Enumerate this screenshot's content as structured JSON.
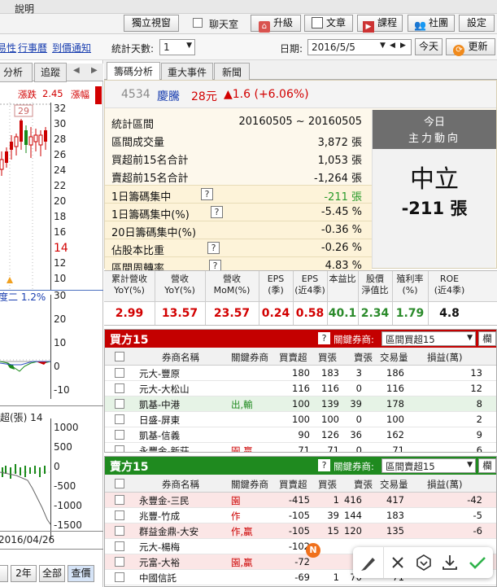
{
  "toolbar": {
    "menu_label": "說明",
    "window_btn": "獨立視窗",
    "chat_label": "聊天室",
    "upgrade_btn": "升級",
    "article_btn": "文章",
    "course_btn": "課程",
    "community_btn": "社團",
    "settings_btn": "設定",
    "links": [
      "易性",
      "行事曆",
      "到價通知"
    ],
    "stat_days_label": "統計天數:",
    "stat_days_value": "1",
    "date_label": "日期:",
    "date_value": "2016/5/5",
    "today_btn": "今天",
    "update_btn": "更新"
  },
  "left": {
    "tabs": [
      "分析",
      "追蹤"
    ],
    "price_change_label": "漲跌",
    "price_change_value": "2.45",
    "amplitude_label": "漲幅",
    "highlight_price": "29",
    "yaxis_top": [
      "32",
      "30",
      "28",
      "26",
      "24",
      "22",
      "20",
      "18",
      "16",
      "14",
      "12",
      "10"
    ],
    "percent_text": "度二 1.2%",
    "yaxis_mid": [
      "30",
      "20",
      "10",
      "0",
      "-10"
    ],
    "volume_label": "超(張) 14",
    "yaxis_bottom": [
      "1000",
      "500",
      "0",
      "-500",
      "-1000",
      "-1500"
    ],
    "date_text": "2016/04/26",
    "range_buttons": [
      "2年",
      "全部",
      "查價"
    ]
  },
  "tabs": [
    "籌碼分析",
    "重大事件",
    "新聞"
  ],
  "stock": {
    "code": "4534",
    "name": "慶騰",
    "price": "28元",
    "change": "▲1.6 (+6.06%)"
  },
  "stats": [
    {
      "label": "統計區間",
      "value": "20160505 ~ 20160505",
      "q": false,
      "color": "#111"
    },
    {
      "label": "區間成交量",
      "value": "3,872 張",
      "q": false,
      "color": "#111"
    },
    {
      "label": "買超前15名合計",
      "value": "1,053 張",
      "q": false,
      "color": "#111"
    },
    {
      "label": "賣超前15名合計",
      "value": "-1,264 張",
      "q": false,
      "color": "#111"
    },
    {
      "label": "1日籌碼集中",
      "value": "-211 張",
      "q": true,
      "color": "#2a9a2a"
    },
    {
      "label": "1日籌碼集中(%)",
      "value": "-5.45 %",
      "q": true,
      "color": "#111"
    },
    {
      "label": "20日籌碼集中(%)",
      "value": "-0.36 %",
      "q": false,
      "color": "#111"
    },
    {
      "label": "佔股本比重",
      "value": "-0.26 %",
      "q": true,
      "color": "#111"
    },
    {
      "label": "區間周轉率",
      "value": "4.83 %",
      "q": true,
      "color": "#111"
    }
  ],
  "today_box": {
    "title": "今日",
    "subtitle": "主力動向",
    "status": "中立",
    "amount": "-211 張"
  },
  "metrics": [
    {
      "head": "累計營收\nYoY(%)",
      "value": "2.99",
      "color": "#d20000"
    },
    {
      "head": "營收\nYoY(%)",
      "value": "13.57",
      "color": "#d20000"
    },
    {
      "head": "營收\nMoM(%)",
      "value": "23.57",
      "color": "#d20000"
    },
    {
      "head": "EPS\n(季)",
      "value": "0.24",
      "color": "#d20000"
    },
    {
      "head": "EPS\n(近4季)",
      "value": "0.58",
      "color": "#d20000"
    },
    {
      "head": "本益比",
      "value": "40.1",
      "color": "#2a8a2a"
    },
    {
      "head": "股價\n淨值比",
      "value": "2.34",
      "color": "#2a8a2a"
    },
    {
      "head": "殖利率\n(%)",
      "value": "1.79",
      "color": "#2a8a2a"
    },
    {
      "head": "ROE\n(近4季)",
      "value": "4.8",
      "color": "#111"
    }
  ],
  "buy": {
    "title": "買方15",
    "key_label": "關鍵券商:",
    "select_value": "區間買超15",
    "cut_label": "欄",
    "headers": [
      "券商名稱",
      "關鍵券商",
      "買賣超",
      "買張",
      "賣張",
      "交易量",
      "損益(萬)"
    ],
    "rows": [
      {
        "name": "元大-豐原",
        "key": "",
        "net": "180",
        "buy": "183",
        "sell": "3",
        "vol": "186",
        "pnl": "13"
      },
      {
        "name": "元大-大松山",
        "key": "",
        "net": "116",
        "buy": "116",
        "sell": "0",
        "vol": "116",
        "pnl": "12"
      },
      {
        "name": "凱基-中港",
        "key": "出,輸",
        "net": "100",
        "buy": "139",
        "sell": "39",
        "vol": "178",
        "pnl": "8"
      },
      {
        "name": "日盛-屏東",
        "key": "",
        "net": "100",
        "buy": "100",
        "sell": "0",
        "vol": "100",
        "pnl": "2"
      },
      {
        "name": "凱基-信義",
        "key": "",
        "net": "90",
        "buy": "126",
        "sell": "36",
        "vol": "162",
        "pnl": "9"
      },
      {
        "name": "永豐金-新莊",
        "key": "園,贏",
        "net": "71",
        "buy": "71",
        "sell": "0",
        "vol": "71",
        "pnl": "6"
      }
    ]
  },
  "sell": {
    "title": "賣方15",
    "key_label": "關鍵券商:",
    "select_value": "區間賣超15",
    "cut_label": "欄",
    "headers": [
      "券商名稱",
      "關鍵券商",
      "買賣超",
      "買張",
      "賣張",
      "交易量",
      "損益(萬)"
    ],
    "rows": [
      {
        "name": "永豐金-三民",
        "key": "園",
        "net": "-415",
        "buy": "1",
        "sell": "416",
        "vol": "417",
        "pnl": "-42"
      },
      {
        "name": "兆豐-竹成",
        "key": "作",
        "net": "-105",
        "buy": "39",
        "sell": "144",
        "vol": "183",
        "pnl": "-5"
      },
      {
        "name": "群益金鼎-大安",
        "key": "作,贏",
        "net": "-105",
        "buy": "15",
        "sell": "120",
        "vol": "135",
        "pnl": "-6"
      },
      {
        "name": "元大-楊梅",
        "key": "",
        "net": "-102",
        "buy": "",
        "sell": "",
        "vol": "",
        "pnl": ""
      },
      {
        "name": "元富-大裕",
        "key": "園,贏",
        "net": "-72",
        "buy": "",
        "sell": "",
        "vol": "",
        "pnl": ""
      },
      {
        "name": "中國信託",
        "key": "",
        "net": "-69",
        "buy": "1",
        "sell": "70",
        "vol": "71",
        "pnl": ""
      }
    ]
  },
  "float_toolbar": {
    "badge": "N",
    "tools": [
      "brush-icon",
      "close-icon",
      "download-circle-icon",
      "download-icon",
      "check-icon"
    ]
  },
  "colors": {
    "buy_header": "#c40000",
    "sell_header": "#1f8a1f",
    "accent": "#d20000"
  }
}
